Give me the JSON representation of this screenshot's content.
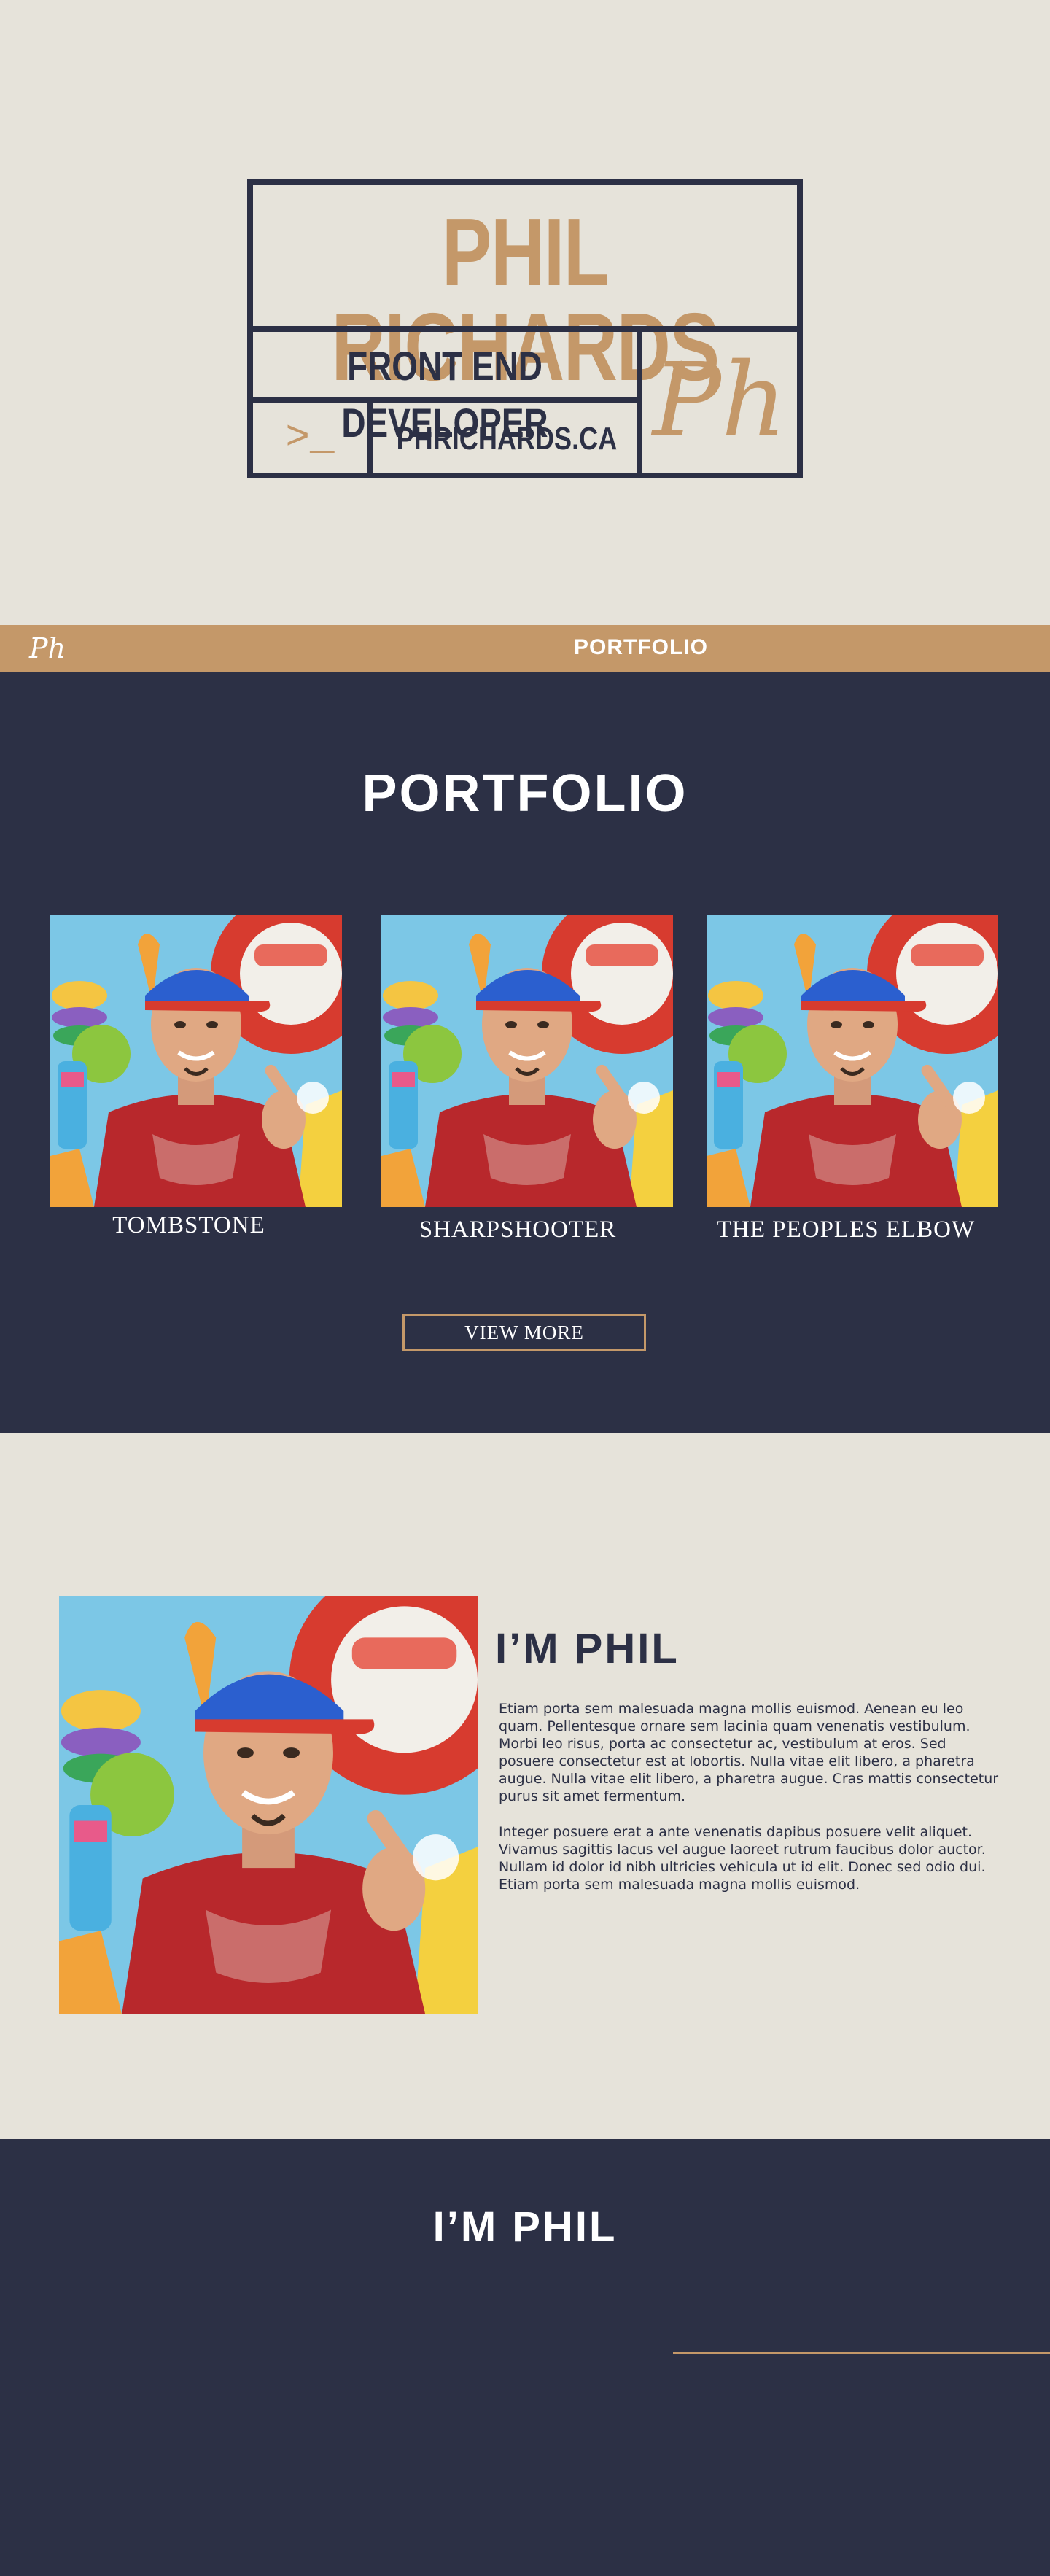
{
  "colors": {
    "navy": "#2c3045",
    "tan": "#c49869",
    "cream": "#e6e3da",
    "white": "#ffffff"
  },
  "hero": {
    "name": "PHIL RICHARDS",
    "role": "FRONT END DEVELOPER",
    "prompt": ">_",
    "domain": "PHRICHARDS.CA",
    "monogram": "Ph"
  },
  "nav": {
    "brand": "Ph",
    "link": "PORTFOLIO"
  },
  "portfolio": {
    "title": "PORTFOLIO",
    "items": [
      {
        "caption": "TOMBSTONE",
        "image_icon": "portrait-photo"
      },
      {
        "caption": "SHARPSHOOTER",
        "image_icon": "portrait-photo"
      },
      {
        "caption": "THE PEOPLES ELBOW",
        "image_icon": "portrait-photo"
      }
    ],
    "view_more": "VIEW MORE"
  },
  "about": {
    "title": "I’M PHIL",
    "paragraphs": [
      "Etiam porta sem malesuada magna mollis euismod. Aenean eu leo quam. Pellentesque ornare sem lacinia quam venenatis vestibulum. Morbi leo risus, porta ac consectetur ac, vestibulum at eros. Sed posuere consectetur est at lobortis. Nulla vitae elit libero, a pharetra augue. Nulla vitae elit libero, a pharetra augue. Cras mattis consectetur purus sit amet fermentum.",
      "Integer posuere erat a ante venenatis dapibus posuere velit aliquet. Vivamus sagittis lacus vel augue laoreet rutrum faucibus dolor auctor. Nullam id dolor id nibh ultricies vehicula ut id elit. Donec sed odio dui. Etiam porta sem malesuada magna mollis euismod."
    ]
  },
  "phil2": {
    "title": "I’M PHIL"
  }
}
